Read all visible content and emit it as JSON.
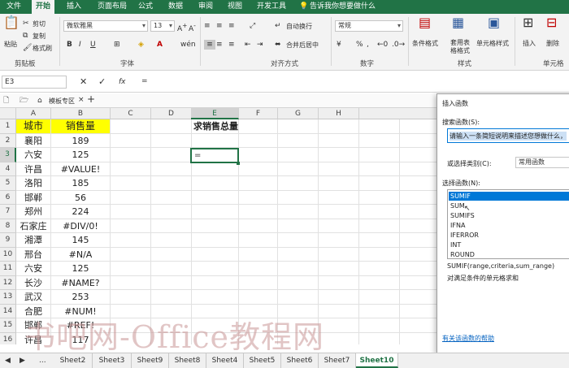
{
  "tabs": [
    "文件",
    "开始",
    "插入",
    "页面布局",
    "公式",
    "数据",
    "审阅",
    "视图",
    "开发工具"
  ],
  "tell_me": "告诉我你想要做什么",
  "ribbon": {
    "paste": "粘贴",
    "cut": "剪切",
    "copy": "复制",
    "format_painter": "格式刷",
    "clipboard_group": "剪贴板",
    "font_name": "微软雅黑",
    "font_size": "13",
    "font_group": "字体",
    "wrap_text": "自动换行",
    "merge_center": "合并后居中",
    "alignment_group": "对齐方式",
    "number_format": "常规",
    "number_group": "数字",
    "conditional_format": "条件格式",
    "format_as_table": "套用表格格式",
    "cell_styles": "单元格样式",
    "styles_group": "样式",
    "insert": "插入",
    "delete": "删除",
    "cells_group": "单元格",
    "bold": "B",
    "italic": "I",
    "underline": "U",
    "percent": "%",
    "comma": ","
  },
  "formula_bar": {
    "name_box": "E3",
    "fx": "fx",
    "content": "="
  },
  "file_tab_label": "模板专区",
  "columns": [
    "A",
    "B",
    "C",
    "D",
    "E",
    "F",
    "G",
    "H"
  ],
  "rows": [
    {
      "n": "1",
      "a": "城市",
      "b": "销售量"
    },
    {
      "n": "2",
      "a": "襄阳",
      "b": "189"
    },
    {
      "n": "3",
      "a": "六安",
      "b": "125"
    },
    {
      "n": "4",
      "a": "许昌",
      "b": "#VALUE!"
    },
    {
      "n": "5",
      "a": "洛阳",
      "b": "185"
    },
    {
      "n": "6",
      "a": "邯郸",
      "b": "56"
    },
    {
      "n": "7",
      "a": "郑州",
      "b": "224"
    },
    {
      "n": "8",
      "a": "石家庄",
      "b": "#DIV/0!"
    },
    {
      "n": "9",
      "a": "湘潭",
      "b": "145"
    },
    {
      "n": "10",
      "a": "邢台",
      "b": "#N/A"
    },
    {
      "n": "11",
      "a": "六安",
      "b": "125"
    },
    {
      "n": "12",
      "a": "长沙",
      "b": "#NAME?"
    },
    {
      "n": "13",
      "a": "武汉",
      "b": "253"
    },
    {
      "n": "14",
      "a": "合肥",
      "b": "#NUM!"
    },
    {
      "n": "15",
      "a": "邯郸",
      "b": "#REF!"
    },
    {
      "n": "16",
      "a": "许昌",
      "b": "117"
    }
  ],
  "e1_text": "求销售总量",
  "e3_text": "=",
  "dialog": {
    "title": "插入函数",
    "search_label": "搜索函数(S):",
    "search_value": "请输入一条简短说明来描述您想做什么，",
    "category_label": "或选择类别(C):",
    "category_value": "常用函数",
    "select_label": "选择函数(N):",
    "functions": [
      "SUMIF",
      "SUM",
      "SUMIFS",
      "IFNA",
      "IFERROR",
      "INT",
      "ROUND"
    ],
    "signature": "SUMIF(range,criteria,sum_range)",
    "description": "对满足条件的单元格求和",
    "help_link": "有关该函数的帮助"
  },
  "sheet_tabs": [
    "Sheet2",
    "Sheet3",
    "Sheet9",
    "Sheet8",
    "Sheet4",
    "Sheet5",
    "Sheet6",
    "Sheet7",
    "Sheet10"
  ],
  "sheet_nav_more": "...",
  "watermark": "书吧网-Office教程网",
  "colors": {
    "excel_green": "#217346",
    "header_yellow": "#ffff00",
    "selection_blue": "#0078d7"
  }
}
